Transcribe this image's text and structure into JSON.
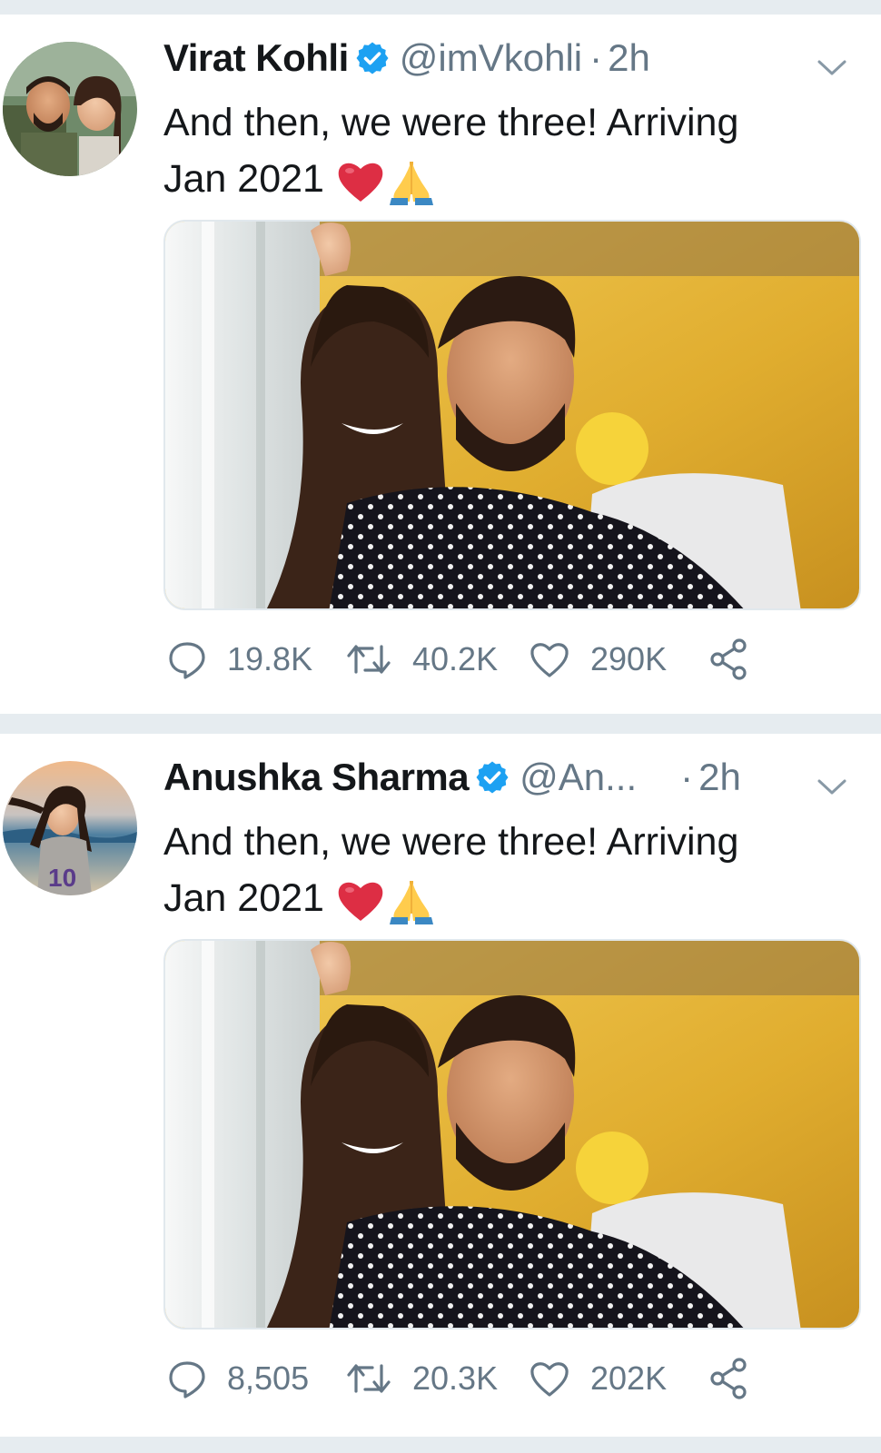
{
  "tweets": [
    {
      "name": "Virat Kohli",
      "handle": "@imVkohli",
      "separator": "·",
      "time": "2h",
      "text_line1": "And then, we were three! Arriving",
      "text_line2": "Jan 2021",
      "emojis": [
        "red-heart",
        "folded-hands"
      ],
      "stats": {
        "replies": "19.8K",
        "retweets": "40.2K",
        "likes": "290K"
      }
    },
    {
      "name": "Anushka Sharma",
      "handle": "@An...",
      "separator": "·",
      "time": "2h",
      "text_line1": "And then, we were three! Arriving",
      "text_line2": "Jan 2021",
      "emojis": [
        "red-heart",
        "folded-hands"
      ],
      "stats": {
        "replies": "8,505",
        "retweets": "20.3K",
        "likes": "202K"
      }
    }
  ],
  "colors": {
    "text": "#14171a",
    "secondary": "#657786",
    "verified": "#1da1f2",
    "divider": "#e6ecf0",
    "photo_wall": "#e6b93a"
  },
  "icons": [
    "verified-badge-icon",
    "chevron-down-icon",
    "reply-icon",
    "retweet-icon",
    "like-icon",
    "share-icon"
  ]
}
